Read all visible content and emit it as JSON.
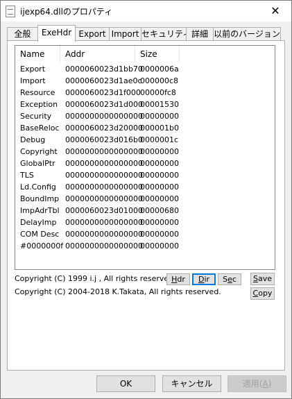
{
  "window": {
    "title": "ijexp64.dllのプロパティ",
    "icon": "document-icon"
  },
  "tabs": [
    {
      "label": "全般",
      "active": false
    },
    {
      "label": "ExeHdr",
      "active": true
    },
    {
      "label": "Export",
      "active": false
    },
    {
      "label": "Import",
      "active": false
    },
    {
      "label": "セキュリティ",
      "active": false
    },
    {
      "label": "詳細",
      "active": false
    },
    {
      "label": "以前のバージョン",
      "active": false
    }
  ],
  "list": {
    "columns": [
      "Name",
      "Addr",
      "Size"
    ],
    "rows": [
      [
        "Export",
        "0000060023d1bb70",
        "0000006a"
      ],
      [
        "Import",
        "0000060023d1ae0c",
        "000000c8"
      ],
      [
        "Resource",
        "0000060023d1f000",
        "00000fc8"
      ],
      [
        "Exception",
        "0000060023d1d000",
        "00001530"
      ],
      [
        "Security",
        "0000000000000000",
        "00000000"
      ],
      [
        "BaseReloc",
        "0000060023d20000",
        "000001b0"
      ],
      [
        "Debug",
        "0000060023d016b0",
        "0000001c"
      ],
      [
        "Copyright",
        "0000000000000000",
        "00000000"
      ],
      [
        "GlobalPtr",
        "0000000000000000",
        "00000000"
      ],
      [
        "TLS",
        "0000000000000000",
        "00000000"
      ],
      [
        "Ld.Config",
        "0000000000000000",
        "00000000"
      ],
      [
        "BoundImp",
        "0000000000000000",
        "00000000"
      ],
      [
        "ImpAdrTbl",
        "0000060023d01000",
        "00000680"
      ],
      [
        "DelayImp",
        "0000000000000000",
        "00000000"
      ],
      [
        "COM Desc",
        "0000000000000000",
        "00000000"
      ],
      [
        "#0000000f",
        "0000000000000000",
        "00000000"
      ]
    ]
  },
  "copyright": {
    "line1": "Copyright (C) 1999 i.j , All rights reserved.",
    "line2": "Copyright (C) 2004-2018 K.Takata, All rights reserved."
  },
  "view_buttons": {
    "hdr": {
      "pre": "",
      "key": "H",
      "post": "dr"
    },
    "dir": {
      "pre": "",
      "key": "D",
      "post": "ir"
    },
    "sec": {
      "pre": "S",
      "key": "e",
      "post": "c"
    }
  },
  "action_buttons": {
    "save": {
      "pre": "",
      "key": "S",
      "post": "ave"
    },
    "copy": {
      "pre": "",
      "key": "C",
      "post": "opy"
    }
  },
  "footer": {
    "ok": "OK",
    "cancel": "キャンセル",
    "apply": {
      "pre": "適用(",
      "key": "A",
      "post": ")"
    }
  },
  "colors": {
    "accent": "#0078d7",
    "background": "#f0f0f0",
    "border": "#adadad"
  }
}
